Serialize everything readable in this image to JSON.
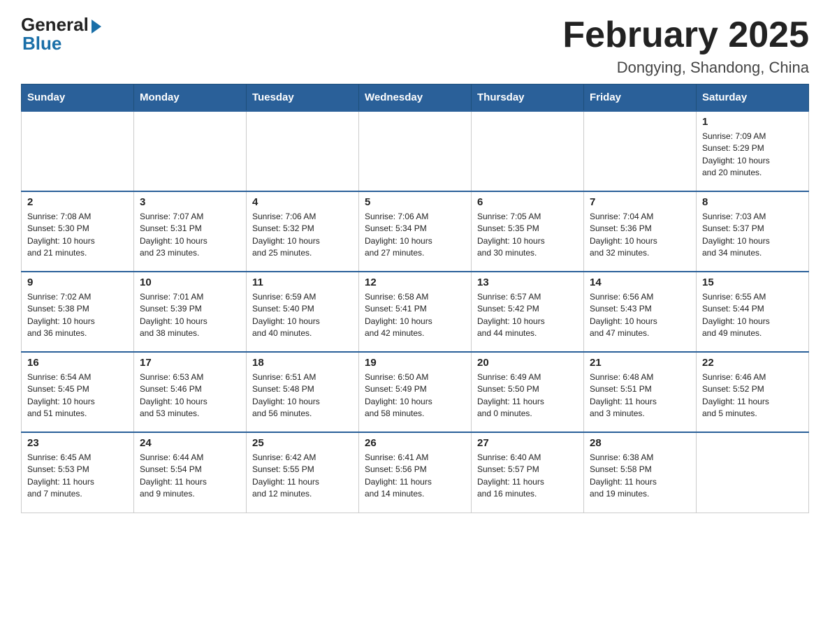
{
  "header": {
    "logo": {
      "general": "General",
      "blue": "Blue"
    },
    "title": "February 2025",
    "subtitle": "Dongying, Shandong, China"
  },
  "weekdays": [
    "Sunday",
    "Monday",
    "Tuesday",
    "Wednesday",
    "Thursday",
    "Friday",
    "Saturday"
  ],
  "weeks": [
    [
      {
        "day": "",
        "info": ""
      },
      {
        "day": "",
        "info": ""
      },
      {
        "day": "",
        "info": ""
      },
      {
        "day": "",
        "info": ""
      },
      {
        "day": "",
        "info": ""
      },
      {
        "day": "",
        "info": ""
      },
      {
        "day": "1",
        "info": "Sunrise: 7:09 AM\nSunset: 5:29 PM\nDaylight: 10 hours\nand 20 minutes."
      }
    ],
    [
      {
        "day": "2",
        "info": "Sunrise: 7:08 AM\nSunset: 5:30 PM\nDaylight: 10 hours\nand 21 minutes."
      },
      {
        "day": "3",
        "info": "Sunrise: 7:07 AM\nSunset: 5:31 PM\nDaylight: 10 hours\nand 23 minutes."
      },
      {
        "day": "4",
        "info": "Sunrise: 7:06 AM\nSunset: 5:32 PM\nDaylight: 10 hours\nand 25 minutes."
      },
      {
        "day": "5",
        "info": "Sunrise: 7:06 AM\nSunset: 5:34 PM\nDaylight: 10 hours\nand 27 minutes."
      },
      {
        "day": "6",
        "info": "Sunrise: 7:05 AM\nSunset: 5:35 PM\nDaylight: 10 hours\nand 30 minutes."
      },
      {
        "day": "7",
        "info": "Sunrise: 7:04 AM\nSunset: 5:36 PM\nDaylight: 10 hours\nand 32 minutes."
      },
      {
        "day": "8",
        "info": "Sunrise: 7:03 AM\nSunset: 5:37 PM\nDaylight: 10 hours\nand 34 minutes."
      }
    ],
    [
      {
        "day": "9",
        "info": "Sunrise: 7:02 AM\nSunset: 5:38 PM\nDaylight: 10 hours\nand 36 minutes."
      },
      {
        "day": "10",
        "info": "Sunrise: 7:01 AM\nSunset: 5:39 PM\nDaylight: 10 hours\nand 38 minutes."
      },
      {
        "day": "11",
        "info": "Sunrise: 6:59 AM\nSunset: 5:40 PM\nDaylight: 10 hours\nand 40 minutes."
      },
      {
        "day": "12",
        "info": "Sunrise: 6:58 AM\nSunset: 5:41 PM\nDaylight: 10 hours\nand 42 minutes."
      },
      {
        "day": "13",
        "info": "Sunrise: 6:57 AM\nSunset: 5:42 PM\nDaylight: 10 hours\nand 44 minutes."
      },
      {
        "day": "14",
        "info": "Sunrise: 6:56 AM\nSunset: 5:43 PM\nDaylight: 10 hours\nand 47 minutes."
      },
      {
        "day": "15",
        "info": "Sunrise: 6:55 AM\nSunset: 5:44 PM\nDaylight: 10 hours\nand 49 minutes."
      }
    ],
    [
      {
        "day": "16",
        "info": "Sunrise: 6:54 AM\nSunset: 5:45 PM\nDaylight: 10 hours\nand 51 minutes."
      },
      {
        "day": "17",
        "info": "Sunrise: 6:53 AM\nSunset: 5:46 PM\nDaylight: 10 hours\nand 53 minutes."
      },
      {
        "day": "18",
        "info": "Sunrise: 6:51 AM\nSunset: 5:48 PM\nDaylight: 10 hours\nand 56 minutes."
      },
      {
        "day": "19",
        "info": "Sunrise: 6:50 AM\nSunset: 5:49 PM\nDaylight: 10 hours\nand 58 minutes."
      },
      {
        "day": "20",
        "info": "Sunrise: 6:49 AM\nSunset: 5:50 PM\nDaylight: 11 hours\nand 0 minutes."
      },
      {
        "day": "21",
        "info": "Sunrise: 6:48 AM\nSunset: 5:51 PM\nDaylight: 11 hours\nand 3 minutes."
      },
      {
        "day": "22",
        "info": "Sunrise: 6:46 AM\nSunset: 5:52 PM\nDaylight: 11 hours\nand 5 minutes."
      }
    ],
    [
      {
        "day": "23",
        "info": "Sunrise: 6:45 AM\nSunset: 5:53 PM\nDaylight: 11 hours\nand 7 minutes."
      },
      {
        "day": "24",
        "info": "Sunrise: 6:44 AM\nSunset: 5:54 PM\nDaylight: 11 hours\nand 9 minutes."
      },
      {
        "day": "25",
        "info": "Sunrise: 6:42 AM\nSunset: 5:55 PM\nDaylight: 11 hours\nand 12 minutes."
      },
      {
        "day": "26",
        "info": "Sunrise: 6:41 AM\nSunset: 5:56 PM\nDaylight: 11 hours\nand 14 minutes."
      },
      {
        "day": "27",
        "info": "Sunrise: 6:40 AM\nSunset: 5:57 PM\nDaylight: 11 hours\nand 16 minutes."
      },
      {
        "day": "28",
        "info": "Sunrise: 6:38 AM\nSunset: 5:58 PM\nDaylight: 11 hours\nand 19 minutes."
      },
      {
        "day": "",
        "info": ""
      }
    ]
  ]
}
